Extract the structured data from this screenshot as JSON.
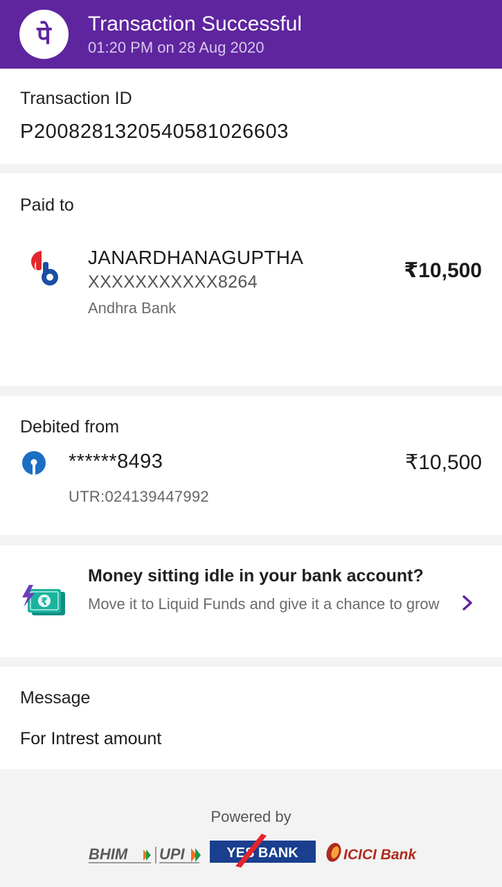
{
  "header": {
    "title": "Transaction Successful",
    "datetime": "01:20 PM on 28 Aug 2020",
    "logo_icon": "phonepe-logo-icon",
    "logo_glyph": "पे"
  },
  "transaction": {
    "label": "Transaction ID",
    "id": "P2008281320540581026603"
  },
  "paid_to": {
    "label": "Paid to",
    "name": "JANARDHANAGUPTHA",
    "account": "XXXXXXXXXXX8264",
    "bank": "Andhra Bank",
    "amount": "₹10,500",
    "icon": "andhra-bank-icon"
  },
  "debited_from": {
    "label": "Debited from",
    "account": "******8493",
    "utr": "UTR:024139447992",
    "amount": "₹10,500",
    "icon": "sbi-bank-icon"
  },
  "promo": {
    "title": "Money sitting idle in your bank account?",
    "subtitle": "Move it to Liquid Funds and give it a chance to grow",
    "icon": "liquid-funds-icon",
    "chevron_icon": "chevron-right-icon"
  },
  "message": {
    "label": "Message",
    "text": "For Intrest amount"
  },
  "footer": {
    "powered_by": "Powered by",
    "partners": [
      {
        "name": "BHIM",
        "icon": "bhim-logo-icon"
      },
      {
        "name": "UPI",
        "icon": "upi-logo-icon"
      },
      {
        "name": "YES BANK",
        "icon": "yes-bank-logo-icon"
      },
      {
        "name": "ICICI Bank",
        "icon": "icici-bank-logo-icon"
      }
    ]
  },
  "colors": {
    "brand_purple": "#5f259f",
    "andhra_red": "#e4262d",
    "andhra_blue": "#1b4ea3",
    "sbi_blue": "#1a6fc4",
    "promo_green": "#1bb39e",
    "yes_blue": "#1a3f8f",
    "icici_orange": "#b02a1d"
  }
}
